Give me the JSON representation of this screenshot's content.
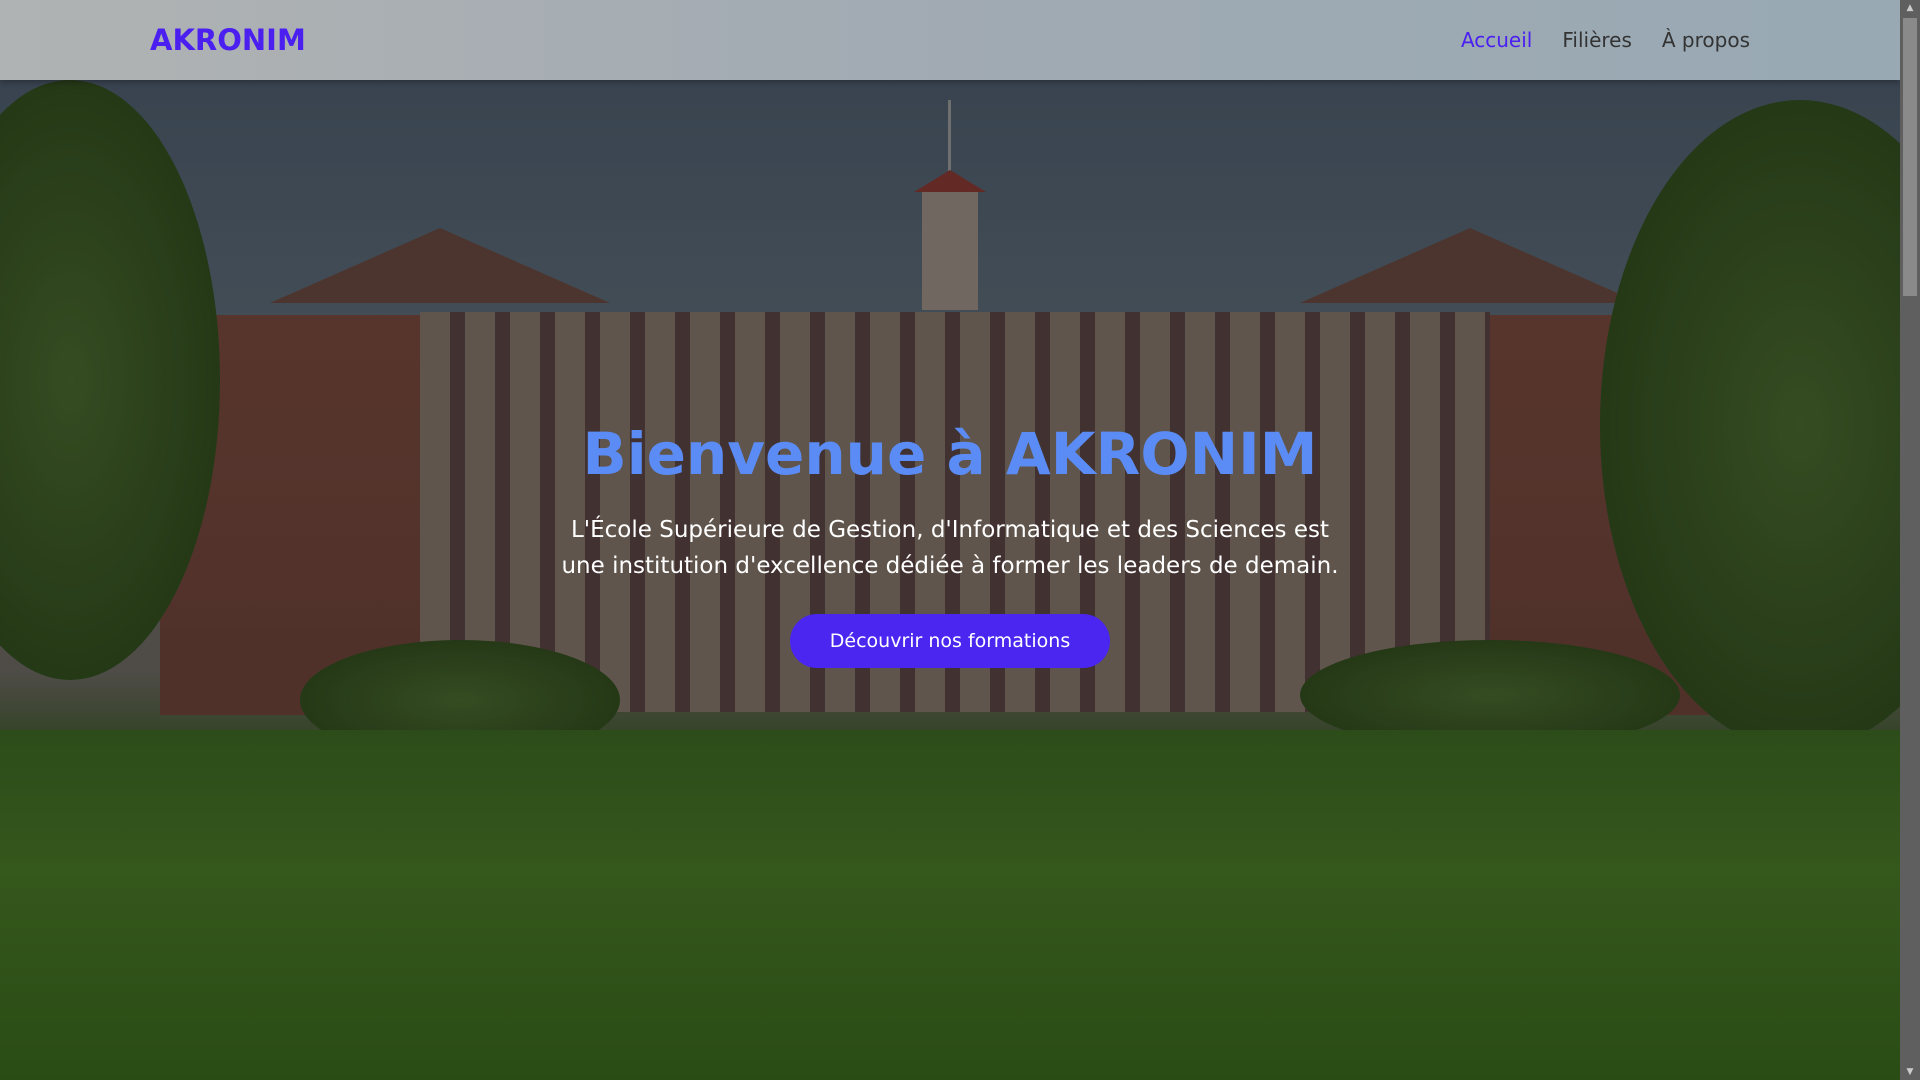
{
  "nav": {
    "logo": "AKRONIM",
    "links": [
      {
        "label": "Accueil",
        "active": true
      },
      {
        "label": "Filières"
      },
      {
        "label": "À propos"
      }
    ]
  },
  "hero": {
    "title": "Bienvenue à AKRONIM",
    "subtitle": "L'École Supérieure de Gestion, d'Informatique et des Sciences est une institution d'excellence dédiée à former les leaders de demain.",
    "cta": "Découvrir nos formations"
  },
  "colors": {
    "accent": "#4a26f0",
    "title": "#5b8cf5"
  }
}
